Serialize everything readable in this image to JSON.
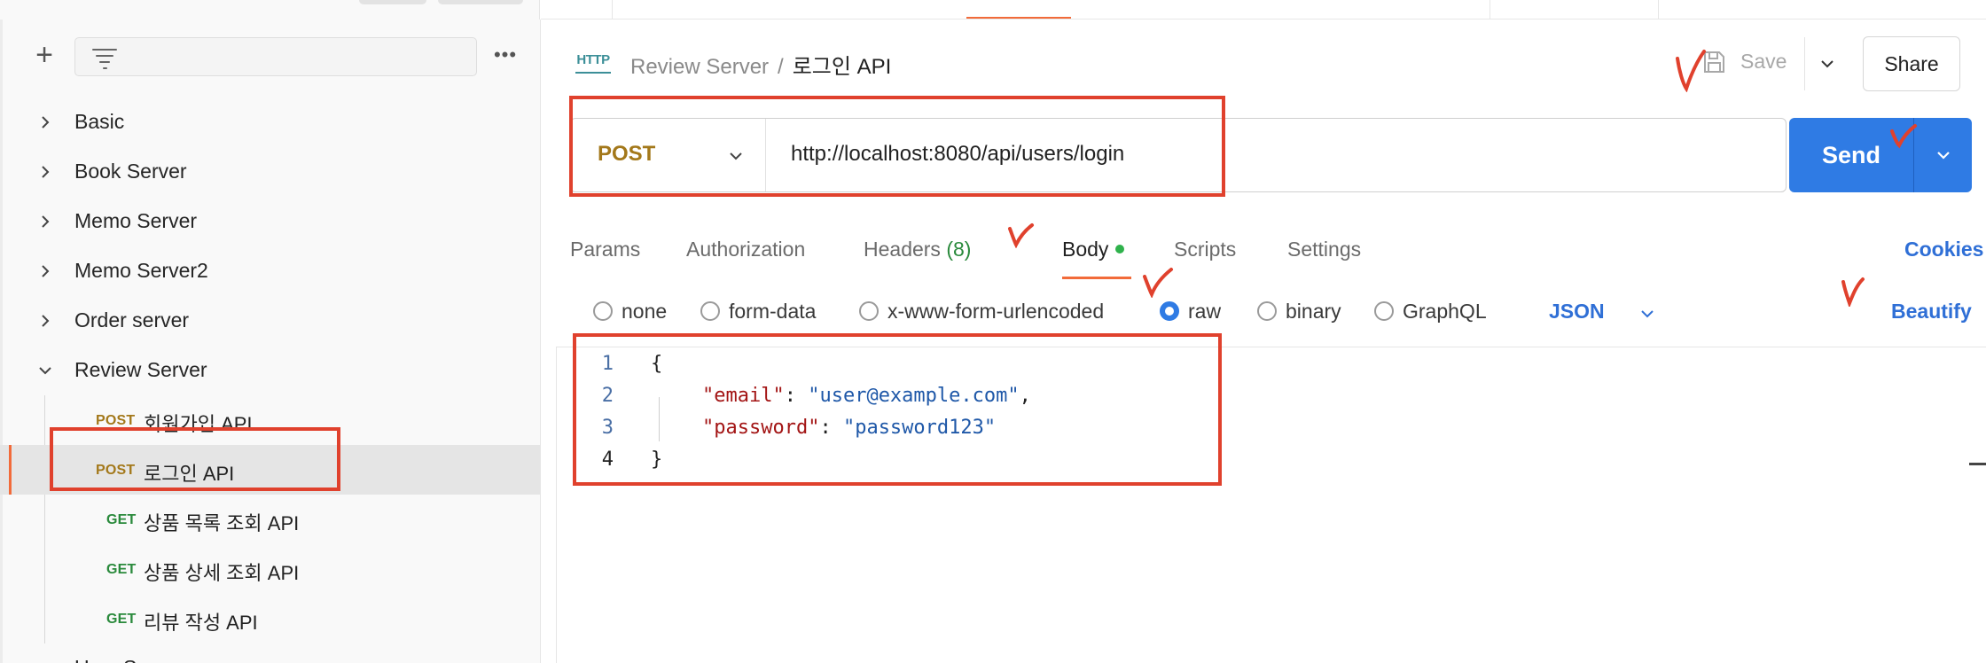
{
  "sidebar": {
    "add_icon": "plus-icon",
    "filter_icon": "filter-icon",
    "more_icon": "more-icon",
    "more_label": "•••",
    "collections": [
      {
        "label": "Basic",
        "expanded": false
      },
      {
        "label": "Book Server",
        "expanded": false
      },
      {
        "label": "Memo Server",
        "expanded": false
      },
      {
        "label": "Memo Server2",
        "expanded": false
      },
      {
        "label": "Order server",
        "expanded": false
      },
      {
        "label": "Review Server",
        "expanded": true
      },
      {
        "label": "User Server",
        "expanded": true
      }
    ],
    "requests": [
      {
        "method": "POST",
        "name": "회원가입 API",
        "active": false
      },
      {
        "method": "POST",
        "name": "로그인 API",
        "active": true
      },
      {
        "method": "GET",
        "name": "상품 목록 조회 API",
        "active": false
      },
      {
        "method": "GET",
        "name": "상품 상세 조회 API",
        "active": false
      },
      {
        "method": "GET",
        "name": "리뷰 작성 API",
        "active": false
      }
    ]
  },
  "header": {
    "icon_label": "HTTP",
    "breadcrumb_parent": "Review Server",
    "breadcrumb_sep": "/",
    "breadcrumb_current": "로그인 API",
    "save_label": "Save",
    "share_label": "Share"
  },
  "request": {
    "method": "POST",
    "url": "http://localhost:8080/api/users/login",
    "send_label": "Send"
  },
  "tabs": {
    "params": "Params",
    "authorization": "Authorization",
    "headers": "Headers",
    "headers_count": "(8)",
    "body": "Body",
    "scripts": "Scripts",
    "settings": "Settings",
    "cookies": "Cookies",
    "active": "Body"
  },
  "body_options": {
    "none": "none",
    "form_data": "form-data",
    "urlencoded": "x-www-form-urlencoded",
    "raw": "raw",
    "binary": "binary",
    "graphql": "GraphQL",
    "selected": "raw",
    "format": "JSON",
    "beautify": "Beautify"
  },
  "editor": {
    "line_numbers": [
      "1",
      "2",
      "3",
      "4"
    ],
    "brace_open": "{",
    "brace_close": "}",
    "key1": "\"email\"",
    "val1": "\"user@example.com\"",
    "key2": "\"password\"",
    "val2": "\"password123\""
  },
  "colors": {
    "accent": "#f26b3a",
    "send_blue": "#2f7be4",
    "post": "#a3781a",
    "get": "#2a8a3c",
    "annotation_red": "#e0412d"
  }
}
